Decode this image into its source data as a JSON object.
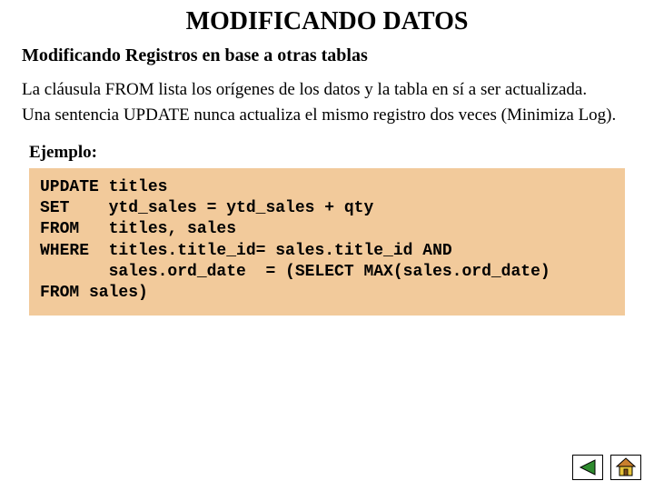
{
  "title": "MODIFICANDO DATOS",
  "subtitle": "Modificando Registros en base a otras tablas",
  "paragraph1": "La cláusula FROM lista los orígenes de los datos y la tabla en sí a ser actualizada.",
  "paragraph2": "Una sentencia UPDATE nunca actualiza el mismo registro dos veces (Minimiza Log).",
  "example_label": "Ejemplo:",
  "code": "UPDATE titles\nSET    ytd_sales = ytd_sales + qty\nFROM   titles, sales\nWHERE  titles.title_id= sales.title_id AND\n       sales.ord_date  = (SELECT MAX(sales.ord_date)\nFROM sales)",
  "nav": {
    "back": "back",
    "home": "home"
  },
  "colors": {
    "code_bg": "#f2ca9b",
    "nav_green": "#2e8b2e",
    "nav_yellow": "#e6c33a"
  }
}
